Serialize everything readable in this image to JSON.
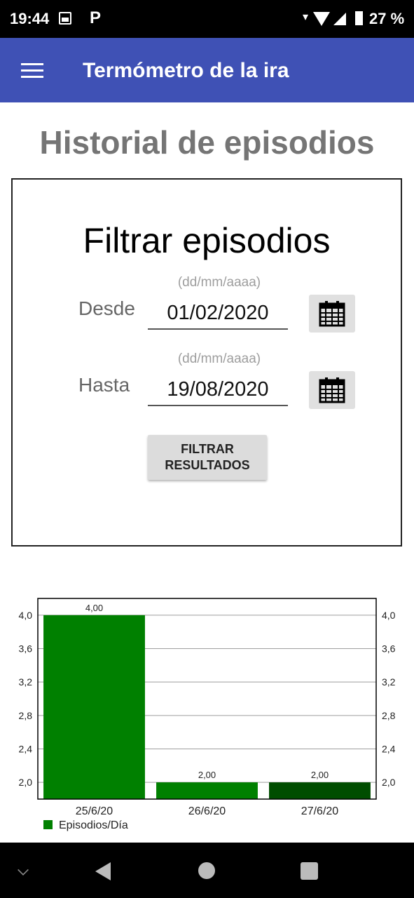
{
  "status_bar": {
    "time": "19:44",
    "battery_percent": "27 %",
    "icons": [
      "image-icon",
      "p-icon",
      "data-arrow-icon",
      "wifi-icon",
      "signal-icon",
      "battery-icon"
    ]
  },
  "app_bar": {
    "title": "Termómetro de la ira",
    "menu_icon": "menu-icon",
    "color": "#3f51b5"
  },
  "page": {
    "title": "Historial de episodios"
  },
  "filter": {
    "title": "Filtrar episodios",
    "from": {
      "label": "Desde",
      "hint": "(dd/mm/aaaa)",
      "value": "01/02/2020",
      "icon": "calendar-icon"
    },
    "to": {
      "label": "Hasta",
      "hint": "(dd/mm/aaaa)",
      "value": "19/08/2020",
      "icon": "calendar-icon"
    },
    "button_line1": "FILTRAR",
    "button_line2": "RESULTADOS"
  },
  "chart_data": {
    "type": "bar",
    "categories": [
      "25/6/20",
      "26/6/20",
      "27/6/20"
    ],
    "series": [
      {
        "name": "Episodios/Día",
        "values": [
          4.0,
          2.0,
          2.0
        ]
      }
    ],
    "value_labels": [
      "4,00",
      "2,00",
      "2,00"
    ],
    "bar_colors": [
      "#008000",
      "#008000",
      "#004d00"
    ],
    "y_ticks": [
      "2,0",
      "2,4",
      "2,8",
      "3,2",
      "3,6",
      "4,0"
    ],
    "y_tick_values": [
      2.0,
      2.4,
      2.8,
      3.2,
      3.6,
      4.0
    ],
    "ylim": [
      1.8,
      4.2
    ],
    "grid": true,
    "legend_position": "bottom-left",
    "axes": "left-and-right"
  },
  "nav_bar": {
    "icons": [
      "chevron-down-icon",
      "back-icon",
      "home-icon",
      "recents-icon"
    ]
  }
}
